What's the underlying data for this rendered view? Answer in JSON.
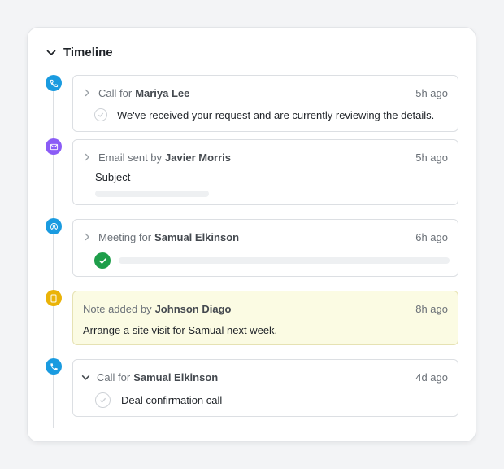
{
  "timeline": {
    "title": "Timeline",
    "items": [
      {
        "type": "call",
        "prefix": "Call for",
        "person": "Mariya Lee",
        "time": "5h ago",
        "body": "We've received your request and are currently reviewing the details.",
        "expanded": false,
        "icon": "phone-icon",
        "color": "#1a9be0"
      },
      {
        "type": "email",
        "prefix": "Email sent by",
        "person": "Javier Morris",
        "time": "5h ago",
        "body": "Subject",
        "expanded": false,
        "icon": "envelope-icon",
        "color": "#8b5cf6"
      },
      {
        "type": "meeting",
        "prefix": "Meeting for",
        "person": "Samual Elkinson",
        "time": "6h ago",
        "expanded": false,
        "icon": "meeting-icon",
        "color": "#1a9be0",
        "done_color": "#1e9e4a"
      },
      {
        "type": "note",
        "prefix": "Note added by",
        "person": "Johnson Diago",
        "time": "8h ago",
        "body": "Arrange a site visit for Samual next week.",
        "icon": "note-icon",
        "color": "#eab308",
        "background": "#fbfbe3"
      },
      {
        "type": "call",
        "prefix": "Call for",
        "person": "Samual Elkinson",
        "time": "4d ago",
        "body": "Deal confirmation call",
        "expanded": true,
        "icon": "phone-icon",
        "color": "#1a9be0"
      }
    ]
  }
}
